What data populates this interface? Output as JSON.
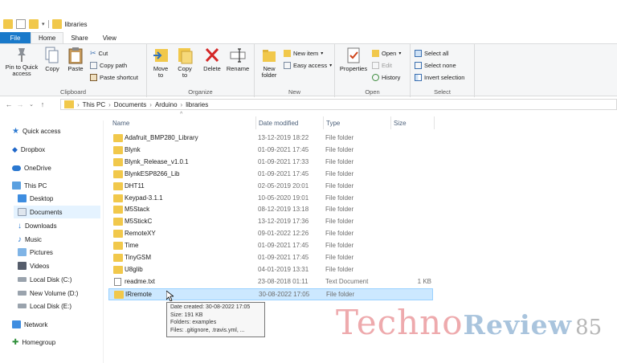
{
  "window": {
    "title": "libraries"
  },
  "ribbon_tabs": [
    "File",
    "Home",
    "Share",
    "View"
  ],
  "ribbon": {
    "clipboard": {
      "pin_label": "Pin to Quick access",
      "copy_label": "Copy",
      "paste_label": "Paste",
      "cut_label": "Cut",
      "copy_path_label": "Copy path",
      "paste_shortcut_label": "Paste shortcut",
      "group_label": "Clipboard"
    },
    "organize": {
      "move_label": "Move to",
      "copy_to_label": "Copy to",
      "delete_label": "Delete",
      "rename_label": "Rename",
      "group_label": "Organize"
    },
    "new": {
      "new_folder_label": "New folder",
      "new_item_label": "New item",
      "easy_access_label": "Easy access",
      "group_label": "New"
    },
    "open": {
      "properties_label": "Properties",
      "open_label": "Open",
      "edit_label": "Edit",
      "history_label": "History",
      "group_label": "Open"
    },
    "select": {
      "select_all_label": "Select all",
      "select_none_label": "Select none",
      "invert_label": "Invert selection",
      "group_label": "Select"
    }
  },
  "breadcrumb": [
    "This PC",
    "Documents",
    "Arduino",
    "libraries"
  ],
  "sidebar": {
    "items": [
      {
        "label": "Quick access",
        "icon": "star-icon"
      },
      {
        "label": "Dropbox",
        "icon": "dropbox-icon"
      },
      {
        "label": "OneDrive",
        "icon": "cloud-icon"
      },
      {
        "label": "This PC",
        "icon": "computer-icon"
      },
      {
        "label": "Desktop",
        "icon": "desktop-icon"
      },
      {
        "label": "Documents",
        "icon": "documents-icon"
      },
      {
        "label": "Downloads",
        "icon": "download-icon"
      },
      {
        "label": "Music",
        "icon": "music-icon"
      },
      {
        "label": "Pictures",
        "icon": "pictures-icon"
      },
      {
        "label": "Videos",
        "icon": "videos-icon"
      },
      {
        "label": "Local Disk (C:)",
        "icon": "drive-icon"
      },
      {
        "label": "New Volume (D:)",
        "icon": "drive-icon"
      },
      {
        "label": "Local Disk (E:)",
        "icon": "drive-icon"
      },
      {
        "label": "Network",
        "icon": "network-icon"
      },
      {
        "label": "Homegroup",
        "icon": "homegroup-icon"
      }
    ]
  },
  "columns": {
    "name": "Name",
    "date": "Date modified",
    "type": "Type",
    "size": "Size"
  },
  "files": [
    {
      "name": "Adafruit_BMP280_Library",
      "date": "13-12-2019 18:22",
      "type": "File folder",
      "size": ""
    },
    {
      "name": "Blynk",
      "date": "01-09-2021 17:45",
      "type": "File folder",
      "size": ""
    },
    {
      "name": "Blynk_Release_v1.0.1",
      "date": "01-09-2021 17:33",
      "type": "File folder",
      "size": ""
    },
    {
      "name": "BlynkESP8266_Lib",
      "date": "01-09-2021 17:45",
      "type": "File folder",
      "size": ""
    },
    {
      "name": "DHT11",
      "date": "02-05-2019 20:01",
      "type": "File folder",
      "size": ""
    },
    {
      "name": "Keypad-3.1.1",
      "date": "10-05-2020 19:01",
      "type": "File folder",
      "size": ""
    },
    {
      "name": "M5Stack",
      "date": "08-12-2019 13:18",
      "type": "File folder",
      "size": ""
    },
    {
      "name": "M5StickC",
      "date": "13-12-2019 17:36",
      "type": "File folder",
      "size": ""
    },
    {
      "name": "RemoteXY",
      "date": "09-01-2022 12:26",
      "type": "File folder",
      "size": ""
    },
    {
      "name": "Time",
      "date": "01-09-2021 17:45",
      "type": "File folder",
      "size": ""
    },
    {
      "name": "TinyGSM",
      "date": "01-09-2021 17:45",
      "type": "File folder",
      "size": ""
    },
    {
      "name": "U8glib",
      "date": "04-01-2019 13:31",
      "type": "File folder",
      "size": ""
    },
    {
      "name": "readme.txt",
      "date": "23-08-2018 01:11",
      "type": "Text Document",
      "size": "1 KB"
    },
    {
      "name": "IRremote",
      "date": "30-08-2022 17:05",
      "type": "File folder",
      "size": ""
    }
  ],
  "tooltip": {
    "line1": "Date created: 30-08-2022 17:05",
    "line2": "Size: 191 KB",
    "line3": "Folders: examples",
    "line4": "Files: .gitignore, .travis.yml, ..."
  },
  "watermark": {
    "part1": "Techno",
    "part2": "Review",
    "part3": "85"
  },
  "colors": {
    "file_tab": "#1979ca",
    "selection": "#cce8ff",
    "folder": "#f1c84b"
  }
}
